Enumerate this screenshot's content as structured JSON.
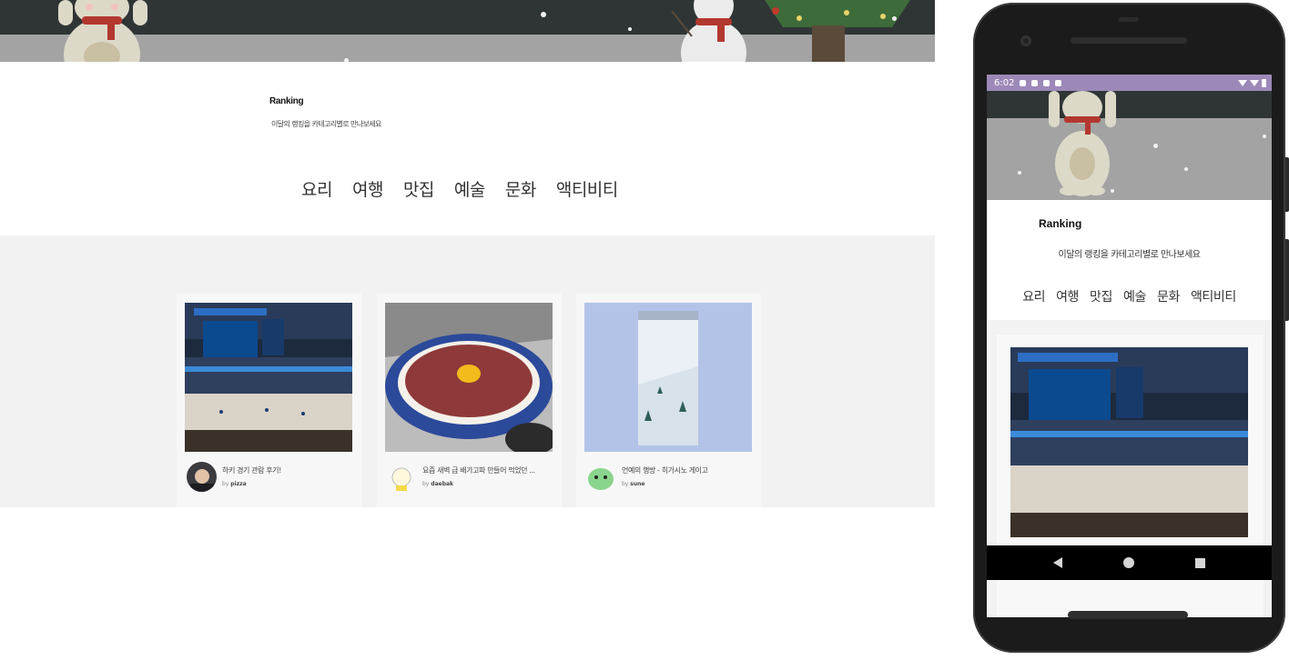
{
  "ranking": {
    "title": "Ranking",
    "subtitle": "이달의 랭킹을 카테고리별로 만나보세요"
  },
  "categories": [
    "요리",
    "여행",
    "맛집",
    "예술",
    "문화",
    "액티비티"
  ],
  "cards": [
    {
      "title": "하키 경기 관람 후기!",
      "by_prefix": "by",
      "author": "pizza",
      "image": "hockey-arena-photo"
    },
    {
      "title": "요즘 새벽 급 배가고파 만들어 먹었던 ...",
      "by_prefix": "by",
      "author": "daebak",
      "image": "beef-rice-bowl-photo"
    },
    {
      "title": "언예의 행방 - 히가시노 게이고",
      "by_prefix": "by",
      "author": "sune",
      "image": "book-cover-photo"
    }
  ],
  "phone": {
    "status_time": "6:02",
    "ranking_title": "Ranking",
    "ranking_subtitle": "이달의 랭킹을 카테고리별로 만나보세요",
    "categories": [
      "요리",
      "여행",
      "맛집",
      "예술",
      "문화",
      "액티비티"
    ]
  },
  "colors": {
    "banner_sky": "#2f3535",
    "banner_ground": "#a3a3a3",
    "section_gray": "#f2f2f2",
    "status_bar": "#9c89b8"
  }
}
